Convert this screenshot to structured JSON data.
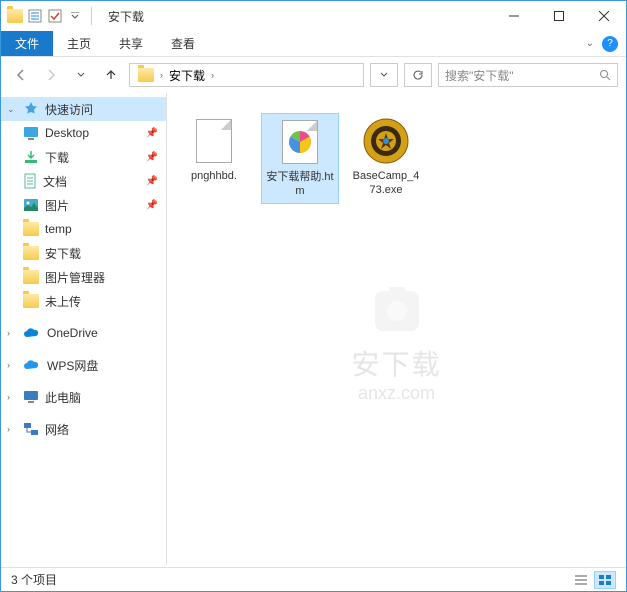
{
  "window": {
    "title": "安下载"
  },
  "ribbon": {
    "file": "文件",
    "tabs": [
      "主页",
      "共享",
      "查看"
    ]
  },
  "breadcrumb": {
    "current": "安下载"
  },
  "search": {
    "placeholder": "搜索\"安下载\""
  },
  "sidebar": {
    "quick_access": "快速访问",
    "pinned": [
      {
        "label": "Desktop"
      },
      {
        "label": "下载"
      },
      {
        "label": "文档"
      },
      {
        "label": "图片"
      }
    ],
    "recent_folders": [
      {
        "label": "temp"
      },
      {
        "label": "安下载"
      },
      {
        "label": "图片管理器"
      },
      {
        "label": "未上传"
      }
    ],
    "sections": [
      {
        "label": "OneDrive",
        "icon": "onedrive"
      },
      {
        "label": "WPS网盘",
        "icon": "wps"
      },
      {
        "label": "此电脑",
        "icon": "thispc"
      },
      {
        "label": "网络",
        "icon": "network"
      }
    ]
  },
  "files": [
    {
      "name": "pnghhbd.",
      "type": "generic",
      "selected": false
    },
    {
      "name": "安下载帮助.htm",
      "type": "htm",
      "selected": true
    },
    {
      "name": "BaseCamp_473.exe",
      "type": "exe",
      "selected": false
    }
  ],
  "watermark": {
    "line1": "安下载",
    "line2": "anxz.com"
  },
  "status": {
    "count": "3 个项目"
  }
}
